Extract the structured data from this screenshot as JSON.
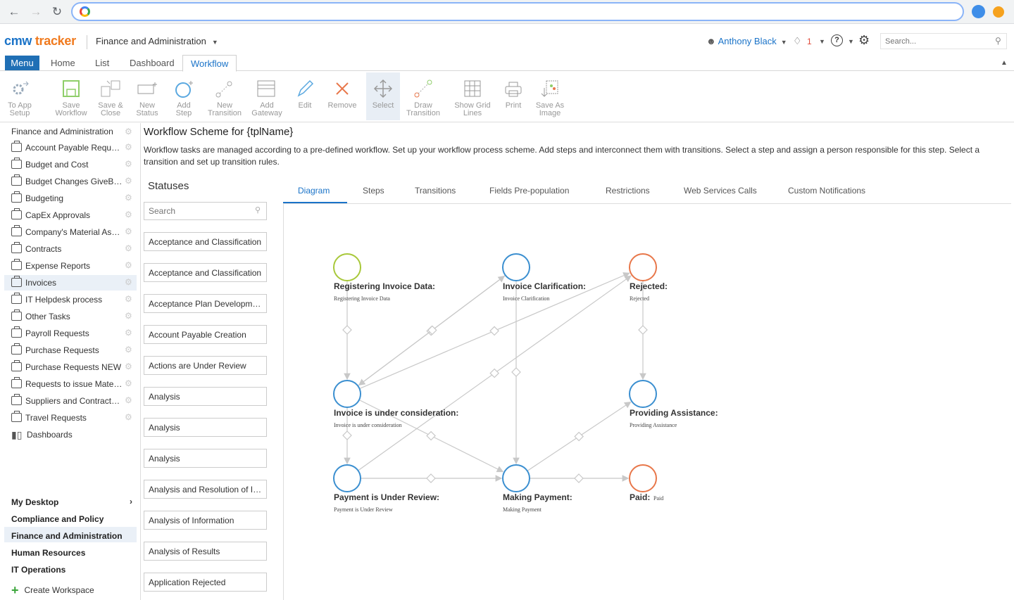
{
  "app": {
    "logo_cmw": "cmw",
    "logo_tracker": "tracker",
    "workspace_title": "Finance and Administration",
    "user_name": "Anthony Black",
    "notifications_count": "1",
    "search_placeholder": "Search..."
  },
  "main_tabs": {
    "menu": "Menu",
    "home": "Home",
    "list": "List",
    "dashboard": "Dashboard",
    "workflow": "Workflow"
  },
  "toolbar": [
    {
      "name": "to-app-setup-button",
      "label": "To App\nSetup",
      "icon": "gear-arrow-icon"
    },
    {
      "name": "save-workflow-button",
      "label": "Save\nWorkflow",
      "icon": "save-icon"
    },
    {
      "name": "save-close-button",
      "label": "Save &\nClose",
      "icon": "save-close-icon"
    },
    {
      "name": "new-status-button",
      "label": "New\nStatus",
      "icon": "new-status-icon"
    },
    {
      "name": "add-step-button",
      "label": "Add\nStep",
      "icon": "add-step-icon"
    },
    {
      "name": "new-transition-button",
      "label": "New\nTransition",
      "icon": "new-transition-icon"
    },
    {
      "name": "add-gateway-button",
      "label": "Add\nGateway",
      "icon": "add-gateway-icon"
    },
    {
      "name": "edit-button",
      "label": "Edit",
      "icon": "pencil-icon"
    },
    {
      "name": "remove-button",
      "label": "Remove",
      "icon": "cross-icon"
    },
    {
      "name": "select-button",
      "label": "Select",
      "icon": "move-icon"
    },
    {
      "name": "draw-transition-button",
      "label": "Draw\nTransition",
      "icon": "draw-transition-icon"
    },
    {
      "name": "show-grid-lines-button",
      "label": "Show Grid\nLines",
      "icon": "grid-icon"
    },
    {
      "name": "print-button",
      "label": "Print",
      "icon": "printer-icon"
    },
    {
      "name": "save-as-image-button",
      "label": "Save As\nImage",
      "icon": "image-download-icon"
    }
  ],
  "sidebar": {
    "group_title": "Finance and Administration",
    "items": [
      "Account Payable Requests",
      "Budget and Cost",
      "Budget Changes GiveBack",
      "Budgeting",
      "CapEx Approvals",
      "Company's Material Assets",
      "Contracts",
      "Expense Reports",
      "Invoices",
      "IT Helpdesk process",
      "Other Tasks",
      "Payroll Requests",
      "Purchase Requests",
      "Purchase Requests NEW",
      "Requests to issue Materials",
      "Suppliers and Contractors",
      "Travel Requests"
    ],
    "active_item": "Invoices",
    "dashboards_label": "Dashboards",
    "workspaces": [
      "My Desktop",
      "Compliance and Policy",
      "Finance and Administration",
      "Human Resources",
      "IT Operations"
    ],
    "active_workspace": "Finance and Administration",
    "create_workspace": "Create Workspace"
  },
  "content": {
    "title": "Workflow Scheme for {tplName}",
    "description": "Workflow tasks are managed according to a pre-defined workflow. Set up your workflow process scheme. Add steps and interconnect them with transitions. Select a step and assign a person responsible for this step. Select a transition and set up transition rules."
  },
  "statuses": {
    "title": "Statuses",
    "search_placeholder": "Search",
    "items": [
      "Acceptance and Classification",
      "Acceptance and Classification",
      "Acceptance Plan Development",
      "Account Payable Creation",
      "Actions are Under Review",
      "Analysis",
      "Analysis",
      "Analysis",
      "Analysis and Resolution of Issues",
      "Analysis of Information",
      "Analysis of Results",
      "Application Rejected"
    ]
  },
  "content_tabs": {
    "diagram": "Diagram",
    "steps": "Steps",
    "transitions": "Transitions",
    "fields_prepopulation": "Fields Pre-population",
    "restrictions": "Restrictions",
    "web_services_calls": "Web Services Calls",
    "custom_notifications": "Custom Notifications"
  },
  "diagram": {
    "colors": {
      "start": "#a8c83a",
      "step": "#3b8fd0",
      "end": "#e8774a",
      "line": "#c8c8c8"
    },
    "nodes": [
      {
        "id": "registering",
        "title": "Registering Invoice Data:",
        "sub": "Registering Invoice Data",
        "kind": "start"
      },
      {
        "id": "clarification",
        "title": "Invoice Clarification:",
        "sub": "Invoice Clarification",
        "kind": "step"
      },
      {
        "id": "rejected",
        "title": "Rejected:",
        "sub": "Rejected",
        "kind": "end"
      },
      {
        "id": "consideration",
        "title": "Invoice is under consideration:",
        "sub": "Invoice is under consideration",
        "kind": "step"
      },
      {
        "id": "assistance",
        "title": "Providing Assistance:",
        "sub": "Providing Assistance",
        "kind": "step"
      },
      {
        "id": "review",
        "title": "Payment is Under Review:",
        "sub": "Payment is Under Review",
        "kind": "step"
      },
      {
        "id": "making",
        "title": "Making Payment:",
        "sub": "Making Payment",
        "kind": "step"
      },
      {
        "id": "paid",
        "title": "Paid:",
        "sub": "Paid",
        "kind": "end"
      }
    ]
  }
}
